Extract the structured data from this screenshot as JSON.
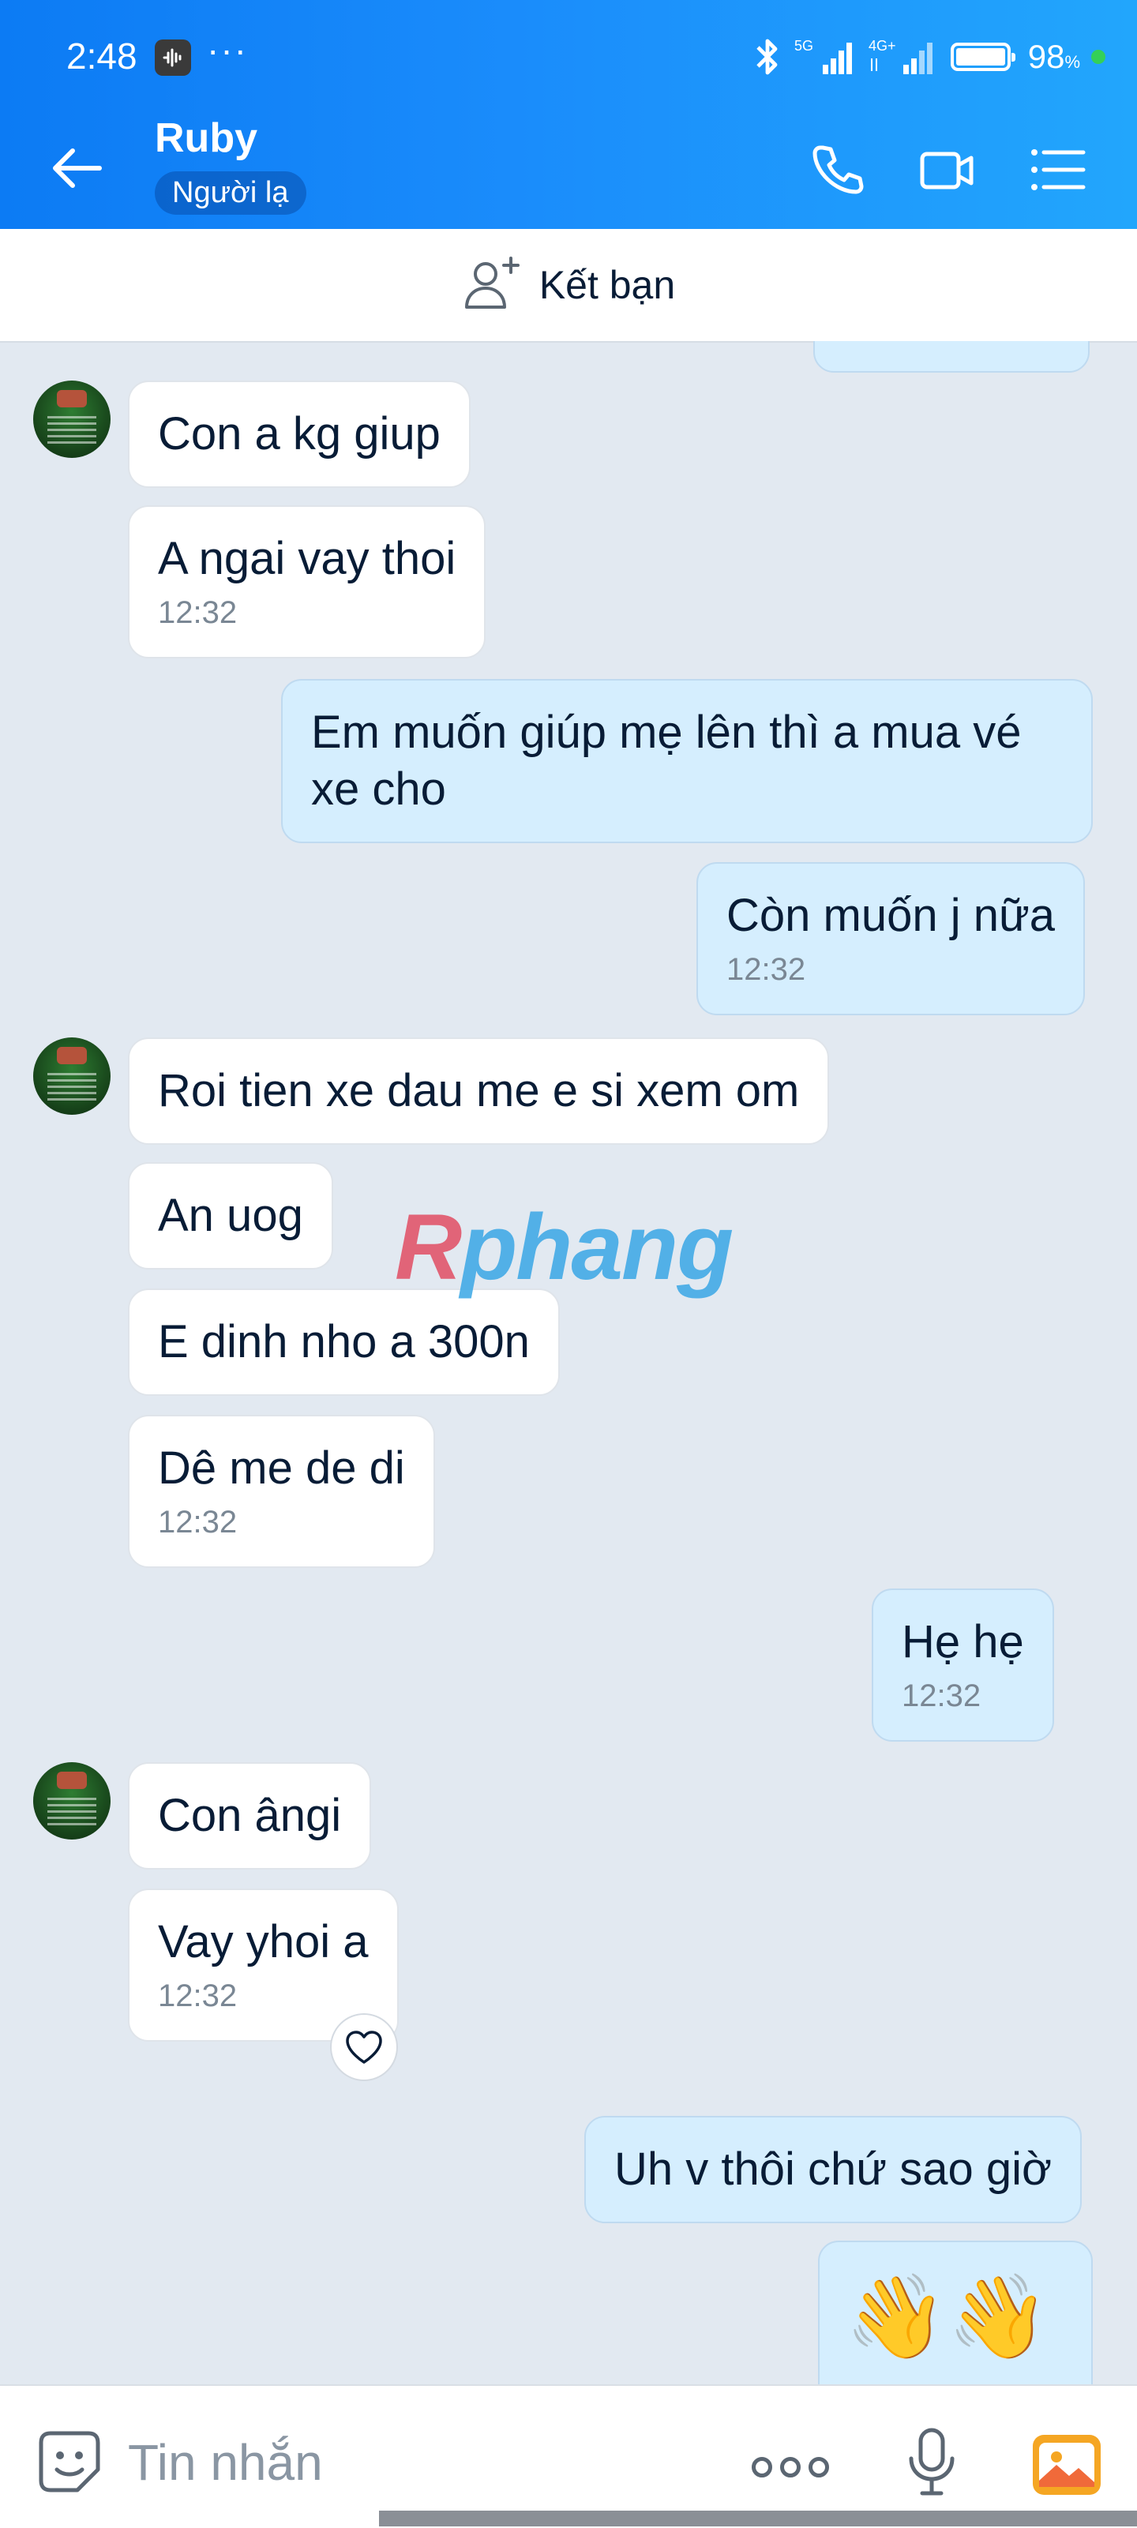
{
  "status_bar": {
    "time": "2:48",
    "dots": "···",
    "battery_percent": "98",
    "percent_sign": "%",
    "network": [
      "5G",
      "4G+"
    ]
  },
  "header": {
    "contact_name": "Ruby",
    "stranger_label": "Người lạ",
    "icons": [
      "back-arrow-icon",
      "phone-icon",
      "video-call-icon",
      "menu-list-icon"
    ]
  },
  "add_friend": {
    "label": "Kết bạn"
  },
  "watermark": {
    "part1": "R",
    "part2": "phang"
  },
  "messages": [
    {
      "sender": "them",
      "text": "Con a kg giup"
    },
    {
      "sender": "them",
      "text": "A ngai vay thoi",
      "time": "12:32"
    },
    {
      "sender": "me",
      "text": "Em muốn giúp mẹ lên thì a mua vé xe cho"
    },
    {
      "sender": "me",
      "text": "Còn muốn j nữa",
      "time": "12:32"
    },
    {
      "sender": "them",
      "text": "Roi tien xe dau me e si xem om"
    },
    {
      "sender": "them",
      "text": "An uog"
    },
    {
      "sender": "them",
      "text": "E dinh nho a 300n"
    },
    {
      "sender": "them",
      "text": "Dê me de di",
      "time": "12:32"
    },
    {
      "sender": "me",
      "text": "Hẹ hẹ",
      "time": "12:32"
    },
    {
      "sender": "them",
      "text": "Con ângi"
    },
    {
      "sender": "them",
      "text": "Vay yhoi a",
      "time": "12:32"
    },
    {
      "sender": "me",
      "text": "Uh v thôi chứ sao giờ"
    },
    {
      "sender": "me",
      "text": "👋👋"
    }
  ],
  "input_bar": {
    "placeholder": "Tin nhắn",
    "icons": [
      "emoji-sticker-icon",
      "more-options-icon",
      "microphone-icon",
      "image-gallery-icon"
    ]
  }
}
